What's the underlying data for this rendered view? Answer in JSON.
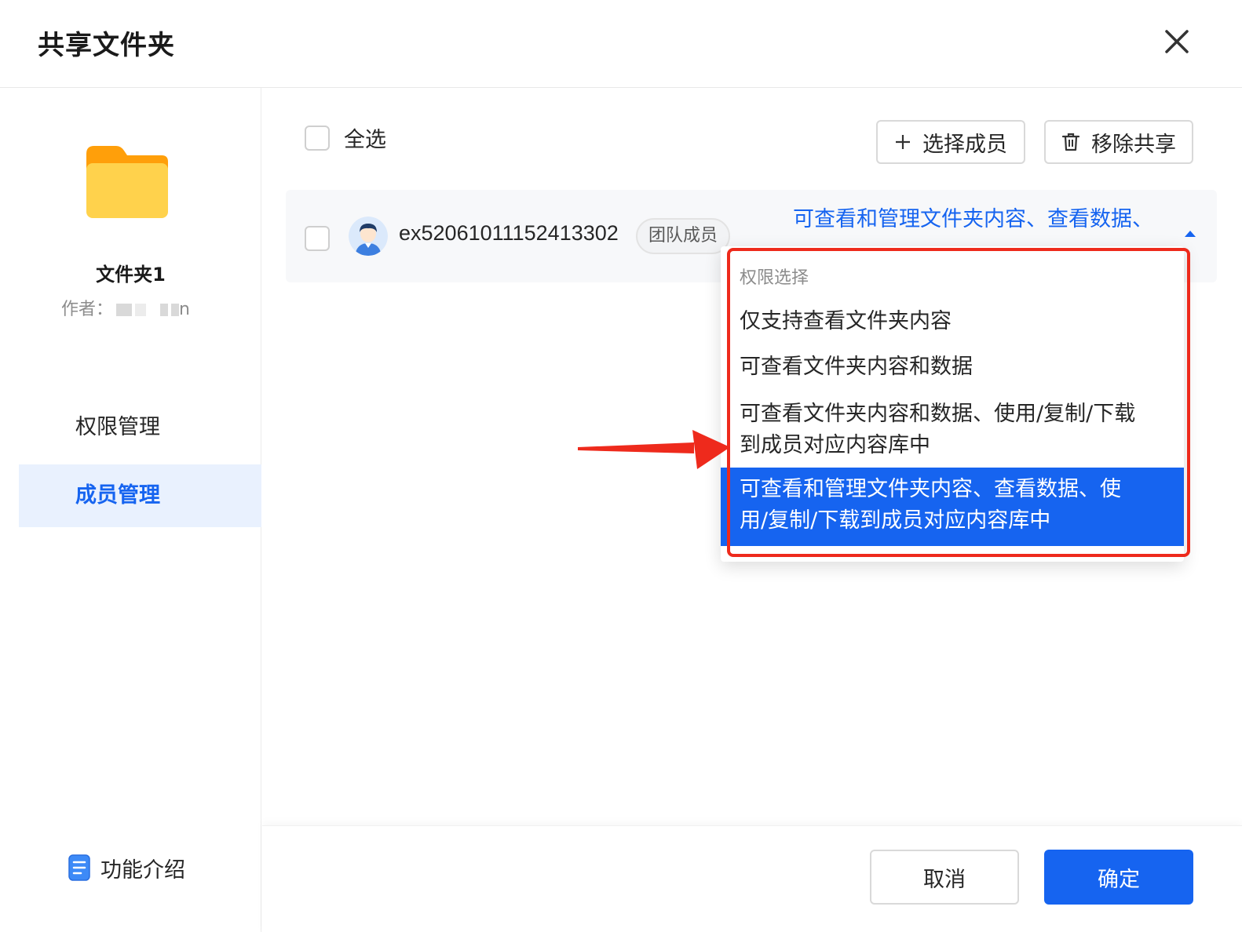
{
  "dialog": {
    "title": "共享文件夹"
  },
  "sidebar": {
    "folder_name": "文件夹1",
    "author_label": "作者：",
    "author_visible_suffix": "n",
    "nav": [
      {
        "label": "权限管理",
        "active": false
      },
      {
        "label": "成员管理",
        "active": true
      }
    ],
    "feature_intro": "功能介绍"
  },
  "toolbar": {
    "select_all": "全选",
    "select_member": "选择成员",
    "remove_share": "移除共享"
  },
  "member": {
    "id": "ex52061011152413302",
    "tag": "团队成员",
    "permission": "可查看和管理文件夹内容、查看数据、"
  },
  "dropdown": {
    "group_label": "权限选择",
    "options": [
      {
        "label": "仅支持查看文件夹内容",
        "selected": false
      },
      {
        "label": "可查看文件夹内容和数据",
        "selected": false
      },
      {
        "label_line1": "可查看文件夹内容和数据、使用/复制/下载",
        "label_line2": "到成员对应内容库中",
        "selected": false
      },
      {
        "label_line1": "可查看和管理文件夹内容、查看数据、使",
        "label_line2": "用/复制/下载到成员对应内容库中",
        "selected": true
      }
    ]
  },
  "footer": {
    "cancel": "取消",
    "confirm": "确定"
  },
  "colors": {
    "primary": "#1664f0",
    "active_nav_bg": "#e9f1fe",
    "highlight": "#ee2a1c",
    "folder": "#ffd24c"
  }
}
